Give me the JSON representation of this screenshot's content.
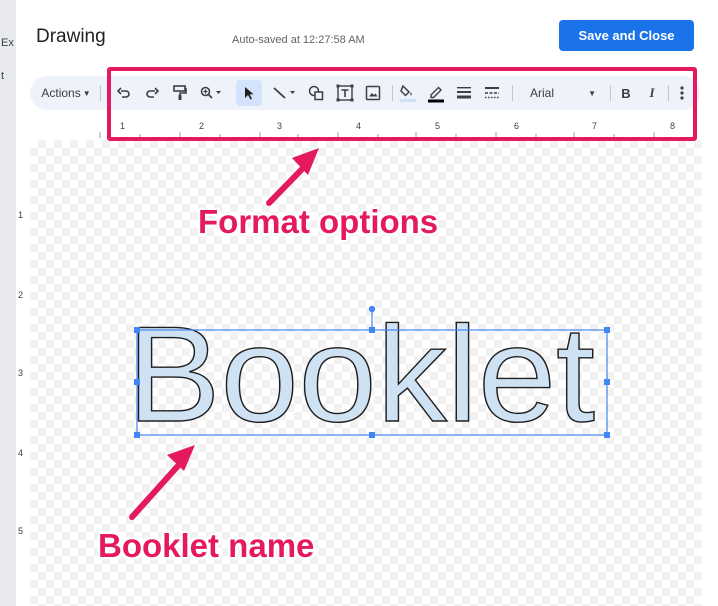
{
  "background": {
    "fragments": [
      "Ex",
      "t"
    ]
  },
  "dialog": {
    "title": "Drawing",
    "autosave": "Auto-saved at 12:27:58 AM",
    "save_button": "Save and Close"
  },
  "toolbar": {
    "actions": "Actions",
    "font": "Arial",
    "bold": "B",
    "italic": "I",
    "icons": [
      "undo-icon",
      "redo-icon",
      "paint-format-icon",
      "zoom-icon",
      "select-icon",
      "line-icon",
      "shape-icon",
      "text-box-icon",
      "image-icon",
      "fill-color-icon",
      "border-color-icon",
      "border-weight-icon",
      "border-dash-icon",
      "more-icon"
    ]
  },
  "ruler": {
    "top": [
      "1",
      "2",
      "3",
      "4",
      "5",
      "6",
      "7",
      "8"
    ],
    "left": [
      "1",
      "2",
      "3",
      "4",
      "5"
    ]
  },
  "canvas": {
    "word_art": "Booklet",
    "selection_color": "#4285f4",
    "word_fill": "#cfe2f3"
  },
  "annotations": {
    "format_options": "Format options",
    "booklet_name": "Booklet name",
    "accent": "#e5195f"
  }
}
